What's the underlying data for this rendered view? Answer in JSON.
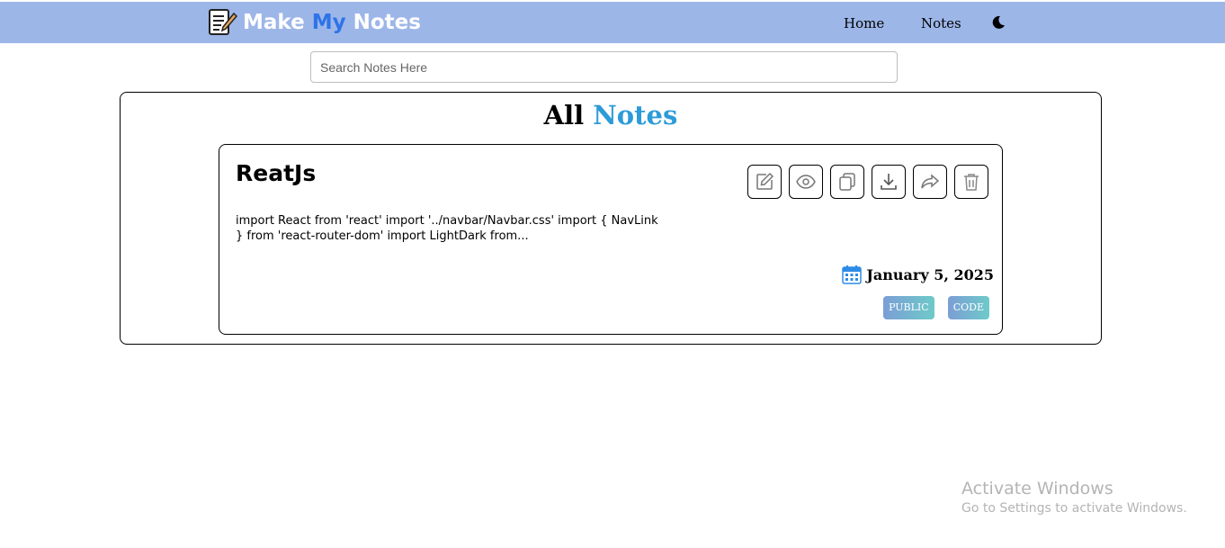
{
  "navbar": {
    "brand_part1": "Make ",
    "brand_part2": "My",
    "brand_part3": " Notes",
    "brand_icon": "notepad-pencil-icon",
    "links": [
      {
        "label": "Home"
      },
      {
        "label": "Notes"
      }
    ],
    "theme_icon": "moon-icon",
    "background_color": "#9db6e8",
    "accent_color": "#2e73e8"
  },
  "search": {
    "placeholder": "Search Notes Here",
    "value": ""
  },
  "section": {
    "title_part1": "All ",
    "title_part2": "Notes",
    "accent_color": "#2d9bd8"
  },
  "notes": [
    {
      "title": "ReatJs",
      "body": "import React from 'react' import '../navbar/Navbar.css' import { NavLink } from 'react-router-dom' import LightDark from...",
      "date": "January 5, 2025",
      "tags": [
        "PUBLIC",
        "CODE"
      ],
      "actions": [
        "edit-icon",
        "view-icon",
        "copy-icon",
        "download-icon",
        "share-icon",
        "delete-icon"
      ]
    }
  ],
  "watermark": {
    "line1": "Activate Windows",
    "line2": "Go to Settings to activate Windows."
  }
}
